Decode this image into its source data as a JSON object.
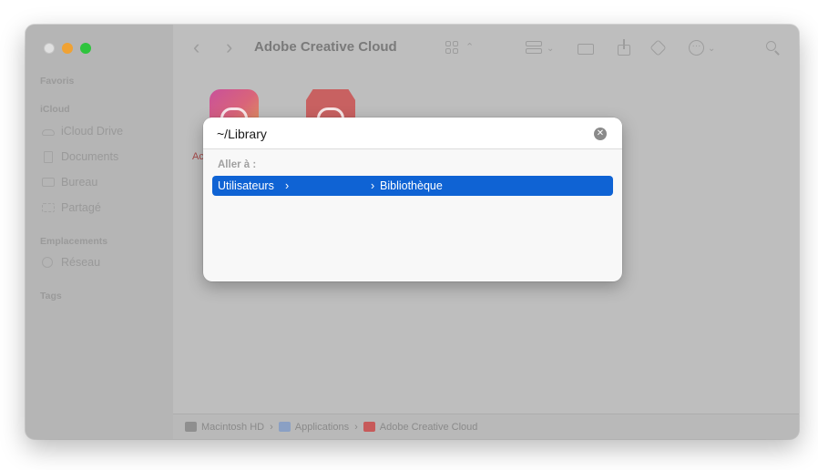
{
  "window": {
    "title": "Adobe Creative Cloud"
  },
  "sidebar": {
    "sections": {
      "favorites": "Favoris",
      "icloud": "iCloud",
      "locations": "Emplacements",
      "tags": "Tags"
    },
    "icloud_items": [
      "iCloud Drive",
      "Documents",
      "Bureau",
      "Partagé"
    ],
    "location_items": [
      "Réseau"
    ]
  },
  "content": {
    "app_label_fragment": "Ac"
  },
  "statusbar": {
    "crumbs": [
      "Macintosh HD",
      "Applications",
      "Adobe Creative Cloud"
    ],
    "separator": "›"
  },
  "goto_dialog": {
    "input_value": "~/Library",
    "section_label": "Aller à :",
    "suggestion": {
      "segment1": "Utilisateurs",
      "arrow1": "›",
      "arrow2": "›",
      "segment2": "Bibliothèque"
    }
  },
  "colors": {
    "accent": "#0f63d4",
    "close": "#e0e0e0",
    "minimize": "#f0a234",
    "maximize": "#2ec43d"
  },
  "icons": [
    "chevron-left-icon",
    "chevron-right-icon",
    "view-grid-icon",
    "group-icon",
    "new-folder-icon",
    "share-icon",
    "tag-icon",
    "more-icon",
    "search-icon"
  ]
}
